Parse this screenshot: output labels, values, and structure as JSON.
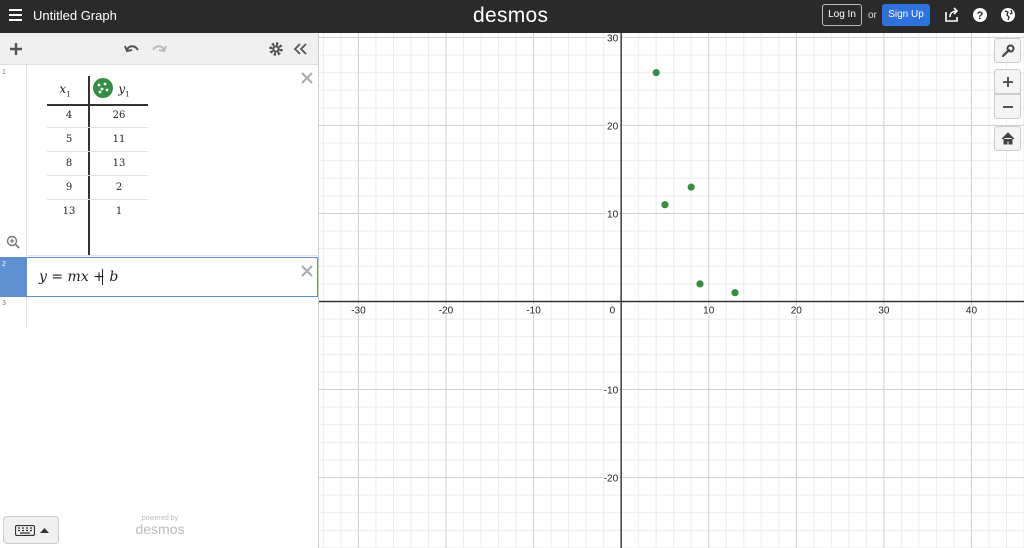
{
  "app": {
    "title": "Untitled Graph",
    "logo": "desmos",
    "login_label": "Log In",
    "or_label": "or",
    "signup_label": "Sign Up",
    "brand_color": "#2a2a2a",
    "accent_color": "#2f72dc"
  },
  "expressions": [
    {
      "number": "1",
      "type": "table",
      "columns": [
        "x",
        "y"
      ],
      "column_subscript": "1",
      "point_color": "#388c46",
      "rows": [
        {
          "x": "4",
          "y": "26"
        },
        {
          "x": "5",
          "y": "11"
        },
        {
          "x": "8",
          "y": "13"
        },
        {
          "x": "9",
          "y": "2"
        },
        {
          "x": "13",
          "y": "1"
        }
      ]
    },
    {
      "number": "2",
      "type": "formula",
      "latex": "y = mx + b"
    },
    {
      "number": "3",
      "type": "empty"
    }
  ],
  "footer": {
    "powered_by": "powered by",
    "powered_logo": "desmos"
  },
  "icons": [
    "menu-icon",
    "share-icon",
    "help-icon",
    "globe-icon",
    "add-icon",
    "undo-icon",
    "redo-icon",
    "settings-icon",
    "collapse-icon",
    "close-icon",
    "zoom-fit-icon",
    "keyboard-icon",
    "wrench-icon",
    "zoom-in-icon",
    "zoom-out-icon",
    "home-icon"
  ],
  "chart_data": {
    "type": "scatter",
    "x": [
      4,
      5,
      8,
      9,
      13
    ],
    "y": [
      26,
      11,
      13,
      2,
      1
    ],
    "xlim": [
      -34.5,
      46
    ],
    "ylim": [
      -28,
      30.5
    ],
    "x_ticks": [
      -30,
      -20,
      -10,
      0,
      10,
      20,
      30,
      40
    ],
    "y_ticks": [
      -20,
      -10,
      10,
      20,
      30
    ],
    "grid": true,
    "point_color": "#388c46"
  }
}
